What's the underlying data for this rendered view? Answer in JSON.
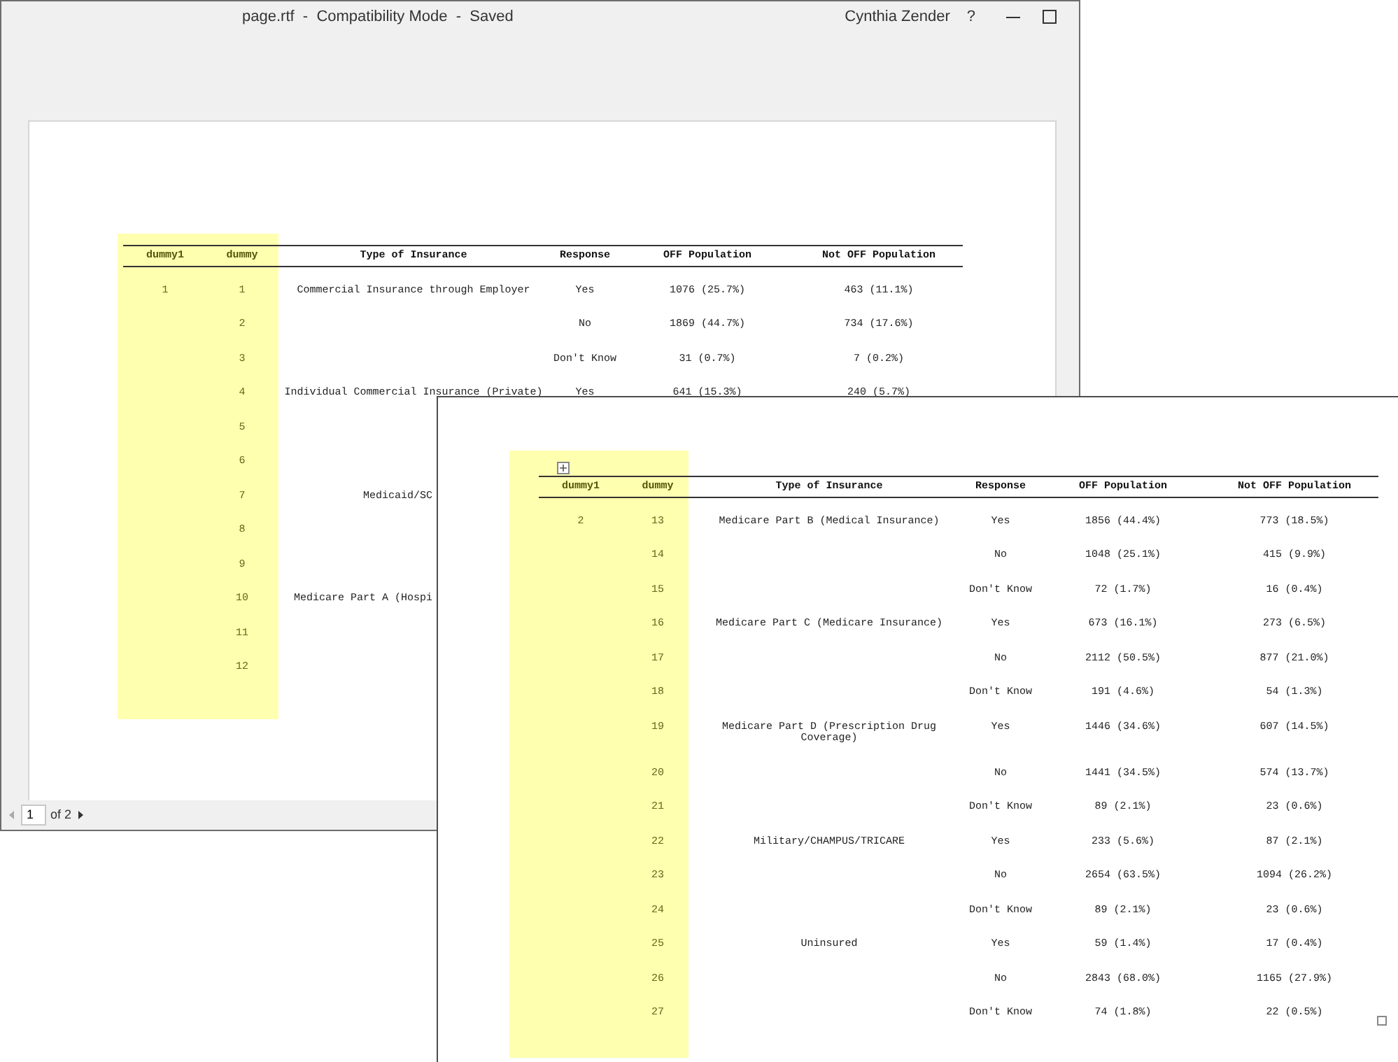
{
  "back_window": {
    "title": "page.rtf  -  Compatibility Mode  -  Saved",
    "user": "Cynthia Zender",
    "help": "?",
    "table": {
      "columns": [
        "dummy1",
        "dummy",
        "Type of Insurance",
        "Response",
        "OFF Population",
        "Not OFF Population"
      ],
      "rows": [
        {
          "dummy1": "1",
          "dummy": "1",
          "type": "Commercial Insurance through Employer",
          "response": "Yes",
          "off": "1076 (25.7%)",
          "not_off": "463 (11.1%)"
        },
        {
          "dummy": "2",
          "response": "No",
          "off": "1869 (44.7%)",
          "not_off": "734 (17.6%)"
        },
        {
          "dummy": "3",
          "response": "Don't Know",
          "off": "31 (0.7%)",
          "not_off": "7 (0.2%)"
        },
        {
          "dummy": "4",
          "type": "Individual Commercial Insurance (Private)",
          "response": "Yes",
          "off": "641 (15.3%)",
          "not_off": "240 (5.7%)"
        },
        {
          "dummy": "5"
        },
        {
          "dummy": "6"
        },
        {
          "dummy": "7",
          "type": "Medicaid/SC",
          "cut": true
        },
        {
          "dummy": "8"
        },
        {
          "dummy": "9"
        },
        {
          "dummy": "10",
          "type": "Medicare Part A (Hospi",
          "cut": true
        },
        {
          "dummy": "11"
        },
        {
          "dummy": "12"
        }
      ]
    },
    "status_bar": {
      "page": "1",
      "of": "of 2"
    }
  },
  "front_window": {
    "table": {
      "columns": [
        "dummy1",
        "dummy",
        "Type of Insurance",
        "Response",
        "OFF Population",
        "Not OFF Population"
      ],
      "rows": [
        {
          "dummy1": "2",
          "dummy": "13",
          "type": "Medicare Part B (Medical Insurance)",
          "response": "Yes",
          "off": "1856 (44.4%)",
          "not_off": "773 (18.5%)"
        },
        {
          "dummy": "14",
          "response": "No",
          "off": "1048 (25.1%)",
          "not_off": "415 (9.9%)"
        },
        {
          "dummy": "15",
          "response": "Don't Know",
          "off": "72 (1.7%)",
          "not_off": "16 (0.4%)"
        },
        {
          "dummy": "16",
          "type": "Medicare Part C (Medicare Insurance)",
          "response": "Yes",
          "off": "673 (16.1%)",
          "not_off": "273 (6.5%)"
        },
        {
          "dummy": "17",
          "response": "No",
          "off": "2112 (50.5%)",
          "not_off": "877 (21.0%)"
        },
        {
          "dummy": "18",
          "response": "Don't Know",
          "off": "191 (4.6%)",
          "not_off": "54 (1.3%)"
        },
        {
          "dummy": "19",
          "type": "Medicare Part D (Prescription Drug Coverage)",
          "response": "Yes",
          "off": "1446 (34.6%)",
          "not_off": "607 (14.5%)"
        },
        {
          "dummy": "20",
          "response": "No",
          "off": "1441 (34.5%)",
          "not_off": "574 (13.7%)"
        },
        {
          "dummy": "21",
          "response": "Don't Know",
          "off": "89 (2.1%)",
          "not_off": "23 (0.6%)"
        },
        {
          "dummy": "22",
          "type": "Military/CHAMPUS/TRICARE",
          "response": "Yes",
          "off": "233 (5.6%)",
          "not_off": "87 (2.1%)"
        },
        {
          "dummy": "23",
          "response": "No",
          "off": "2654 (63.5%)",
          "not_off": "1094 (26.2%)"
        },
        {
          "dummy": "24",
          "response": "Don't Know",
          "off": "89 (2.1%)",
          "not_off": "23 (0.6%)"
        },
        {
          "dummy": "25",
          "type": "Uninsured",
          "response": "Yes",
          "off": "59 (1.4%)",
          "not_off": "17 (0.4%)"
        },
        {
          "dummy": "26",
          "response": "No",
          "off": "2843 (68.0%)",
          "not_off": "1165 (27.9%)"
        },
        {
          "dummy": "27",
          "response": "Don't Know",
          "off": "74 (1.8%)",
          "not_off": "22 (0.5%)"
        }
      ]
    }
  }
}
